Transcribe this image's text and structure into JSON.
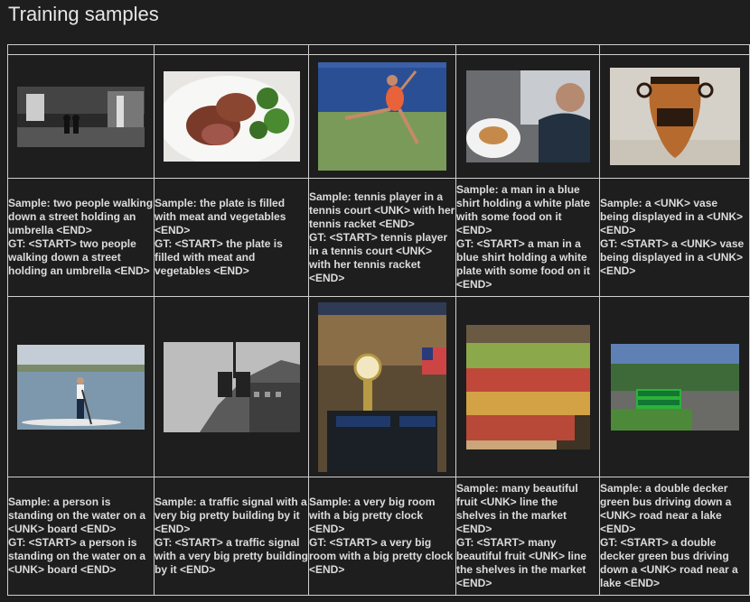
{
  "page": {
    "title": "Training samples"
  },
  "samples": [
    {
      "sample": "Sample: two people walking down a street holding an umbrella <END>",
      "gt": "GT: <START> two people walking down a street holding an umbrella <END>"
    },
    {
      "sample": "Sample: the plate is filled with meat and vegetables <END>",
      "gt": "GT: <START> the plate is filled with meat and vegetables <END>"
    },
    {
      "sample": "Sample: tennis player in a tennis court <UNK> with her tennis racket <END>",
      "gt": "GT: <START> tennis player in a tennis court <UNK> with her tennis racket <END>"
    },
    {
      "sample": "Sample: a man in a blue shirt holding a white plate with some food on it <END>",
      "gt": "GT: <START> a man in a blue shirt holding a white plate with some food on it <END>"
    },
    {
      "sample": "Sample: a <UNK> vase being displayed in a <UNK> <END>",
      "gt": "GT: <START> a <UNK> vase being displayed in a <UNK> <END>"
    },
    {
      "sample": "Sample: a person is standing on the water on a <UNK> board <END>",
      "gt": "GT: <START> a person is standing on the water on a <UNK> board <END>"
    },
    {
      "sample": "Sample: a traffic signal with a very big pretty building by it <END>",
      "gt": "GT: <START> a traffic signal with a very big pretty building by it <END>"
    },
    {
      "sample": "Sample: a very big room with a big pretty clock <END>",
      "gt": "GT: <START> a very big room with a big pretty clock <END>"
    },
    {
      "sample": "Sample: many beautiful fruit <UNK> line the shelves in the market <END>",
      "gt": "GT: <START> many beautiful fruit <UNK> line the shelves in the market <END>"
    },
    {
      "sample": "Sample: a double decker green bus driving down a <UNK> road near a lake <END>",
      "gt": "GT: <START> a double decker green bus driving down a <UNK> road near a lake <END>"
    }
  ]
}
